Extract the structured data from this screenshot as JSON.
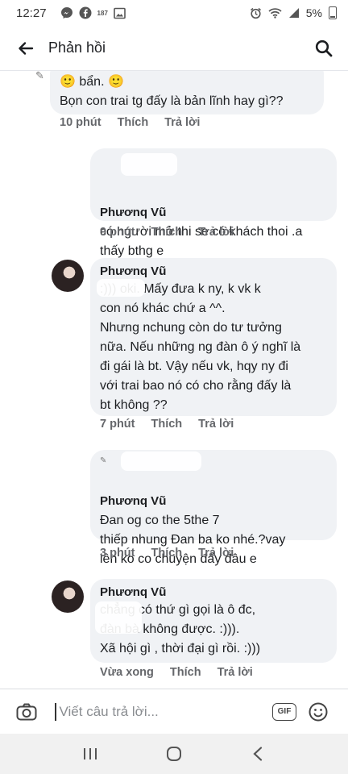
{
  "status_bar": {
    "time": "12:27",
    "left_icons": [
      "messenger-icon",
      "facebook-icon",
      "notification-icon",
      "image-icon"
    ],
    "notification_text": "187",
    "battery": "5%"
  },
  "header": {
    "title": "Phản hồi",
    "back_icon": "arrow-left-icon",
    "search_icon": "search-icon"
  },
  "comments": [
    {
      "author": "",
      "text": "🙂 bẩn. 🙂\nBọn con trai tg đấy là bản lĩnh hay gì??",
      "meta": {
        "time": "10 phút",
        "like": "Thích",
        "reply": "Trả lời"
      }
    },
    {
      "author": "Phươnq Vũ",
      "text": "có người mở thi se có khách thoi .a thấy bthg e",
      "meta": {
        "time": "9 phút",
        "like": "Thích",
        "reply": "Trả lời"
      }
    },
    {
      "author": "Phươnq Vũ",
      "text": ":))) oki. Mấy đưa k ny, k vk k\ncon nó khác chứ a ^^.\nNhưng nchung còn do tư tưởng\nnữa. Nếu những ng đàn ô ý nghĩ là\nđi gái là bt. Vậy nếu vk, hqy ny đi\nvới trai bao nó có cho rằng đấy là\nbt không ??",
      "meta": {
        "time": "7 phút",
        "like": "Thích",
        "reply": "Trả lời"
      }
    },
    {
      "author": "Phươnq Vũ",
      "text": "Đan og co the 5the 7\nthiếp nhung Đan ba ko nhé.?vay\nlên ko co chuyện đấy đâu e",
      "meta": {
        "time": "3 phút",
        "like": "Thích",
        "reply": "Trả lời"
      }
    },
    {
      "author": "Phươnq Vũ",
      "text": "chẳng có thứ gì gọi là  ô đc,\nđàn bà không được. :))).\nXã hội gì , thời đại gì rồi. :)))",
      "meta": {
        "time": "Vừa xong",
        "like": "Thích",
        "reply": "Trả lời"
      }
    }
  ],
  "composer": {
    "placeholder": "Viết câu trả lời...",
    "gif_label": "GIF",
    "camera_icon": "camera-icon",
    "emoji_icon": "smiley-icon"
  },
  "nav": {
    "recent": "|||",
    "home": "○",
    "back": "‹"
  },
  "colors": {
    "bubble": "#f0f2f5",
    "meta": "#65676b",
    "text": "#1c1e21"
  }
}
